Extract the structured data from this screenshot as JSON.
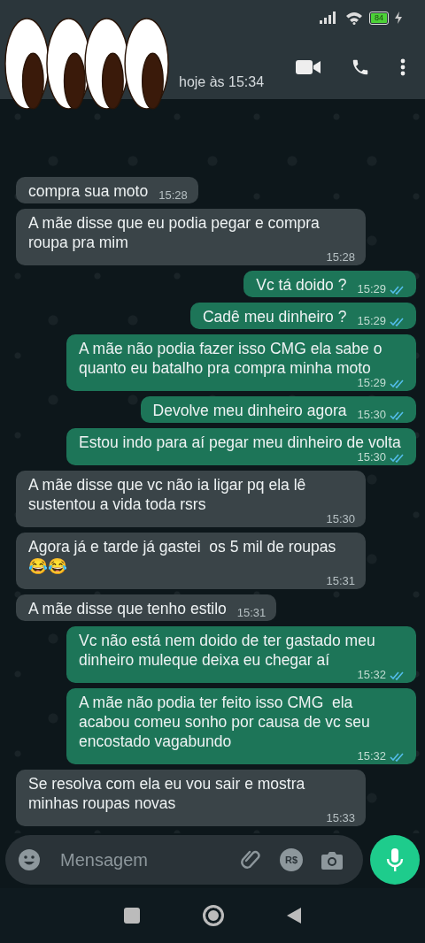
{
  "status_bar": {
    "battery": "84"
  },
  "header": {
    "subtitle": "hoje às 15:34"
  },
  "messages": [
    {
      "kind": "incoming",
      "text": "compra sua moto",
      "time": "15:28"
    },
    {
      "kind": "incoming",
      "text": "A mãe disse que eu podia pegar e compra roupa pra mim",
      "time": "15:28"
    },
    {
      "kind": "outgoing",
      "text": "Vc tá doido ?",
      "time": "15:29",
      "read": true
    },
    {
      "kind": "outgoing",
      "text": "Cadê meu dinheiro ?",
      "time": "15:29",
      "read": true
    },
    {
      "kind": "outgoing",
      "text": "A mãe não podia fazer isso CMG ela sabe o quanto eu batalho pra compra minha moto",
      "time": "15:29",
      "read": true
    },
    {
      "kind": "outgoing",
      "text": "Devolve meu dinheiro agora",
      "time": "15:30",
      "read": true
    },
    {
      "kind": "outgoing",
      "text": "Estou indo para aí pegar meu dinheiro de volta",
      "time": "15:30",
      "read": true
    },
    {
      "kind": "incoming",
      "text": "A mãe disse que vc não ia ligar pq ela lê sustentou a vida toda rsrs",
      "time": "15:30"
    },
    {
      "kind": "incoming",
      "text": "Agora já e tarde já gastei  os 5 mil de roupas 😂😂",
      "time": "15:31"
    },
    {
      "kind": "incoming",
      "text": "A mãe disse que tenho estilo",
      "time": "15:31"
    },
    {
      "kind": "outgoing",
      "text": "Vc não está nem doido de ter gastado meu dinheiro muleque deixa eu chegar aí",
      "time": "15:32",
      "read": true
    },
    {
      "kind": "outgoing",
      "text": "A mãe não podia ter feito isso CMG  ela acabou comeu sonho por causa de vc seu encostado vagabundo",
      "time": "15:32",
      "read": true
    },
    {
      "kind": "incoming",
      "text": "Se resolva com ela eu vou sair e mostra minhas roupas novas",
      "time": "15:33"
    }
  ],
  "composer": {
    "placeholder": "Mensagem",
    "currency": "R$"
  }
}
